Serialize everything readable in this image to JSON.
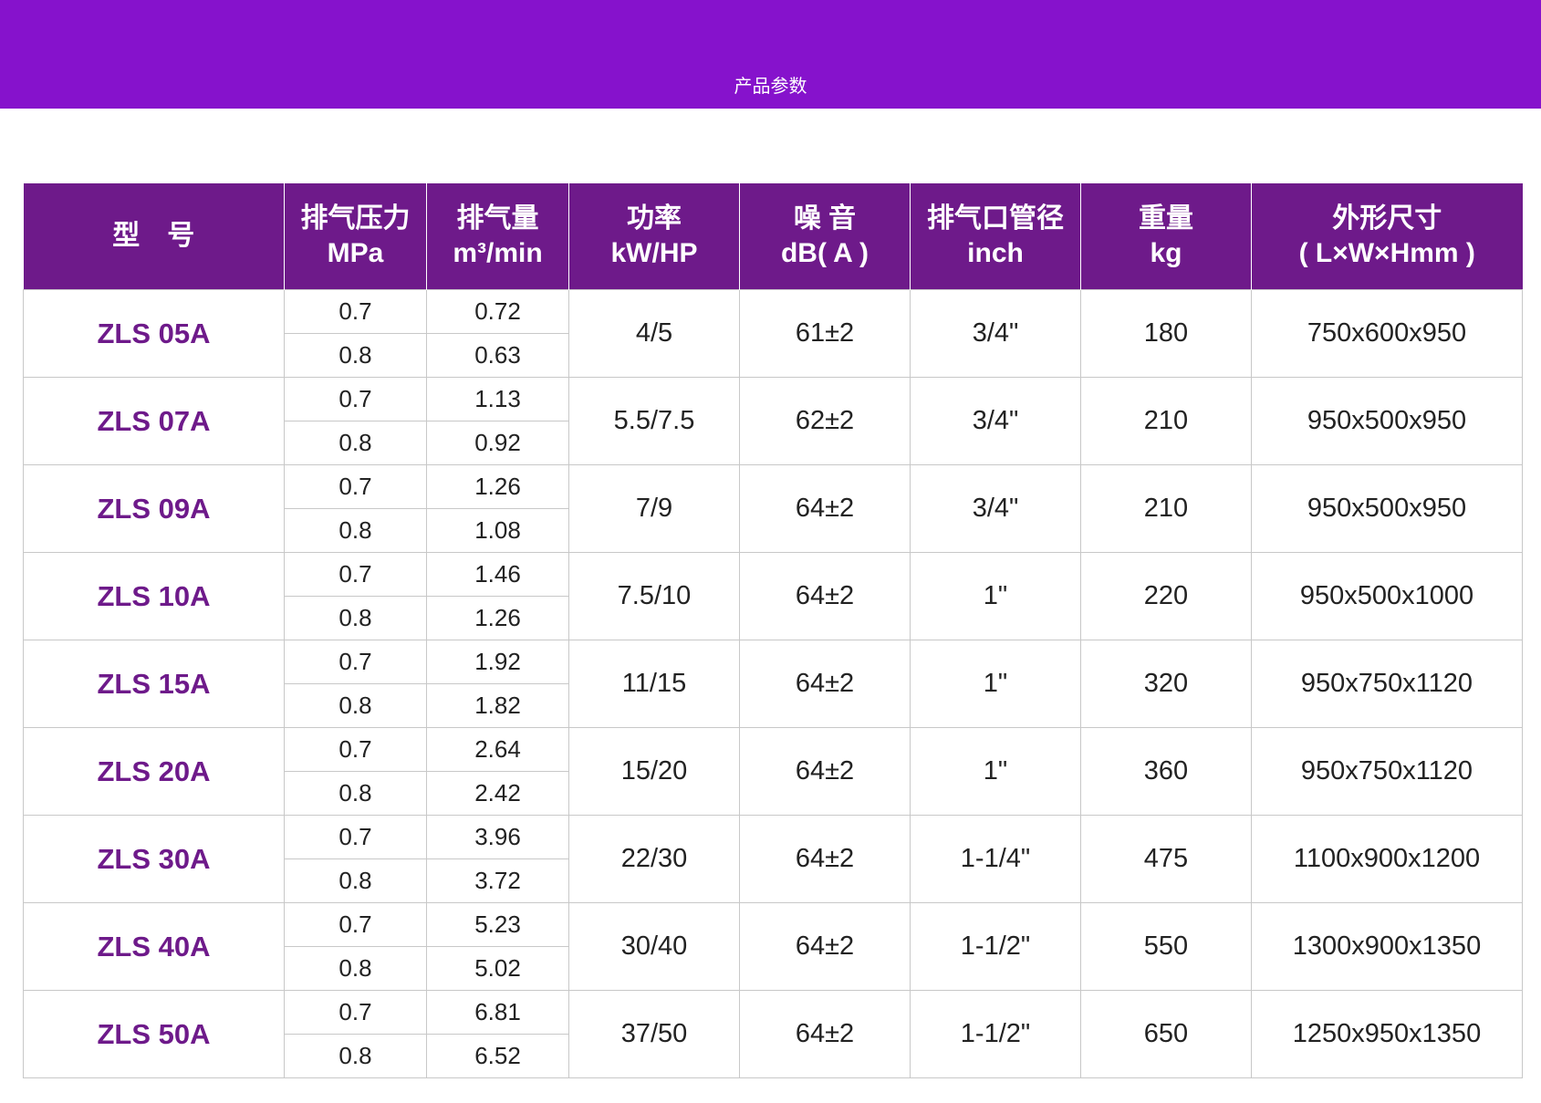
{
  "banner": {
    "title": "产品参数",
    "color": "#8612cc"
  },
  "table": {
    "header_color": "#6e1a8a",
    "model_color": "#6e1a8a",
    "headers": [
      {
        "line1": "型　号",
        "line2": ""
      },
      {
        "line1": "排气压力",
        "line2": "MPa"
      },
      {
        "line1": "排气量",
        "line2": "m³/min"
      },
      {
        "line1": "功率",
        "line2": "kW/HP"
      },
      {
        "line1": "噪 音",
        "line2": "dB( A )"
      },
      {
        "line1": "排气口管径",
        "line2": "inch"
      },
      {
        "line1": "重量",
        "line2": "kg"
      },
      {
        "line1": "外形尺寸",
        "line2": "( L×W×Hmm )"
      }
    ],
    "rows": [
      {
        "model": "ZLS 05A",
        "pressure": [
          "0.7",
          "0.8"
        ],
        "flow": [
          "0.72",
          "0.63"
        ],
        "power": "4/5",
        "noise": "61±2",
        "outlet": "3/4\"",
        "weight": "180",
        "dimensions": "750x600x950"
      },
      {
        "model": "ZLS 07A",
        "pressure": [
          "0.7",
          "0.8"
        ],
        "flow": [
          "1.13",
          "0.92"
        ],
        "power": "5.5/7.5",
        "noise": "62±2",
        "outlet": "3/4\"",
        "weight": "210",
        "dimensions": "950x500x950"
      },
      {
        "model": "ZLS 09A",
        "pressure": [
          "0.7",
          "0.8"
        ],
        "flow": [
          "1.26",
          "1.08"
        ],
        "power": "7/9",
        "noise": "64±2",
        "outlet": "3/4\"",
        "weight": "210",
        "dimensions": "950x500x950"
      },
      {
        "model": "ZLS 10A",
        "pressure": [
          "0.7",
          "0.8"
        ],
        "flow": [
          "1.46",
          "1.26"
        ],
        "power": "7.5/10",
        "noise": "64±2",
        "outlet": "1\"",
        "weight": "220",
        "dimensions": "950x500x1000"
      },
      {
        "model": "ZLS 15A",
        "pressure": [
          "0.7",
          "0.8"
        ],
        "flow": [
          "1.92",
          "1.82"
        ],
        "power": "11/15",
        "noise": "64±2",
        "outlet": "1\"",
        "weight": "320",
        "dimensions": "950x750x1120"
      },
      {
        "model": "ZLS 20A",
        "pressure": [
          "0.7",
          "0.8"
        ],
        "flow": [
          "2.64",
          "2.42"
        ],
        "power": "15/20",
        "noise": "64±2",
        "outlet": "1\"",
        "weight": "360",
        "dimensions": "950x750x1120"
      },
      {
        "model": "ZLS 30A",
        "pressure": [
          "0.7",
          "0.8"
        ],
        "flow": [
          "3.96",
          "3.72"
        ],
        "power": "22/30",
        "noise": "64±2",
        "outlet": "1-1/4\"",
        "weight": "475",
        "dimensions": "1100x900x1200"
      },
      {
        "model": "ZLS 40A",
        "pressure": [
          "0.7",
          "0.8"
        ],
        "flow": [
          "5.23",
          "5.02"
        ],
        "power": "30/40",
        "noise": "64±2",
        "outlet": "1-1/2\"",
        "weight": "550",
        "dimensions": "1300x900x1350"
      },
      {
        "model": "ZLS 50A",
        "pressure": [
          "0.7",
          "0.8"
        ],
        "flow": [
          "6.81",
          "6.52"
        ],
        "power": "37/50",
        "noise": "64±2",
        "outlet": "1-1/2\"",
        "weight": "650",
        "dimensions": "1250x950x1350"
      }
    ]
  }
}
